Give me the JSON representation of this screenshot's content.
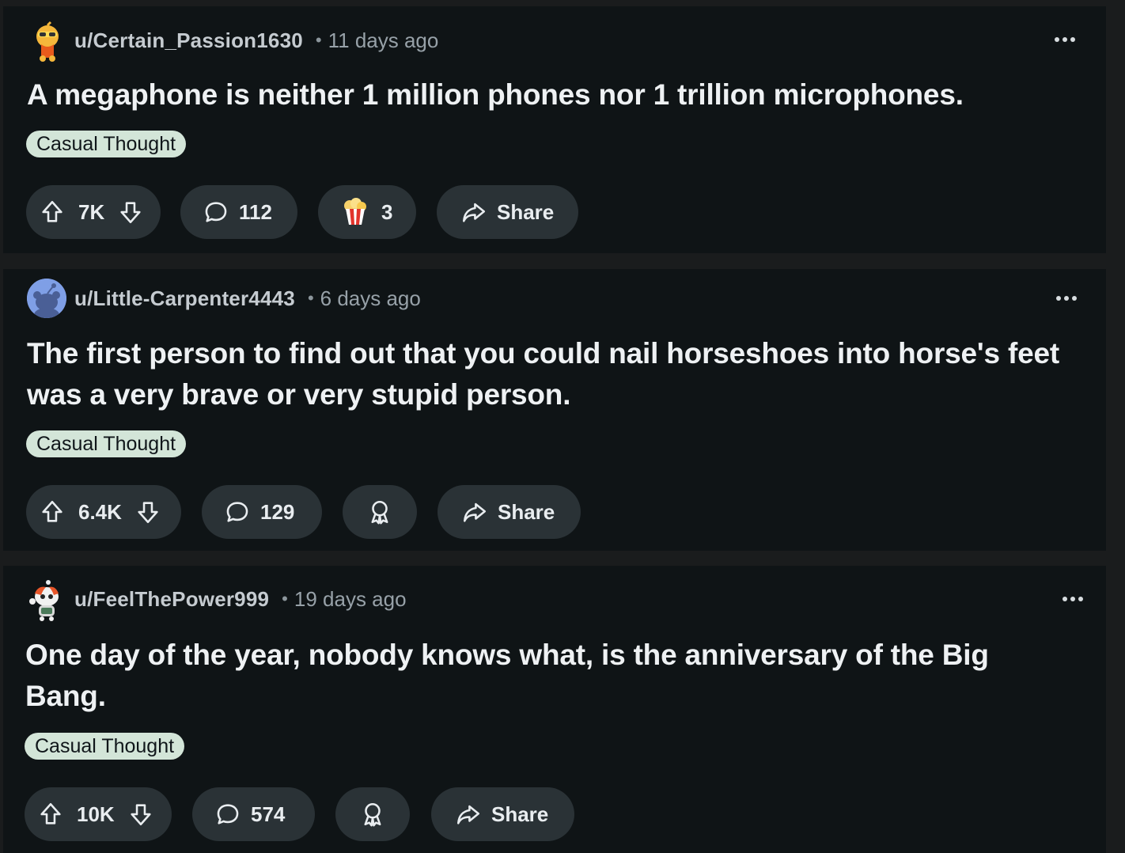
{
  "posts": [
    {
      "username": "u/Certain_Passion1630",
      "separator": "•",
      "time": "11 days ago",
      "title": "A megaphone is neither 1 million phones nor 1 trillion microphones.",
      "flair": "Casual Thought",
      "votes": "7K",
      "comments": "112",
      "awards": "3",
      "share": "Share",
      "avatar_icon": "snoo-avatar-icon"
    },
    {
      "username": "u/Little-Carpenter4443",
      "separator": "•",
      "time": "6 days ago",
      "title": "The first person to find out that you could nail horseshoes into horse's feet was a very brave or very stupid person.",
      "flair": "Casual Thought",
      "votes": "6.4K",
      "comments": "129",
      "share": "Share",
      "avatar_icon": "default-snoo-avatar-icon"
    },
    {
      "username": "u/FeelThePower999",
      "separator": "•",
      "time": "19 days ago",
      "title": "One day of the year, nobody knows what, is the anniversary of the Big Bang.",
      "flair": "Casual Thought",
      "votes": "10K",
      "comments": "574",
      "share": "Share",
      "avatar_icon": "snoo-avatar-icon"
    }
  ],
  "colors": {
    "background": "#0f1416",
    "pill": "#2a3236",
    "flair": "#d3e5d8",
    "text": "#eef1f3",
    "muted": "#97a1a8"
  }
}
